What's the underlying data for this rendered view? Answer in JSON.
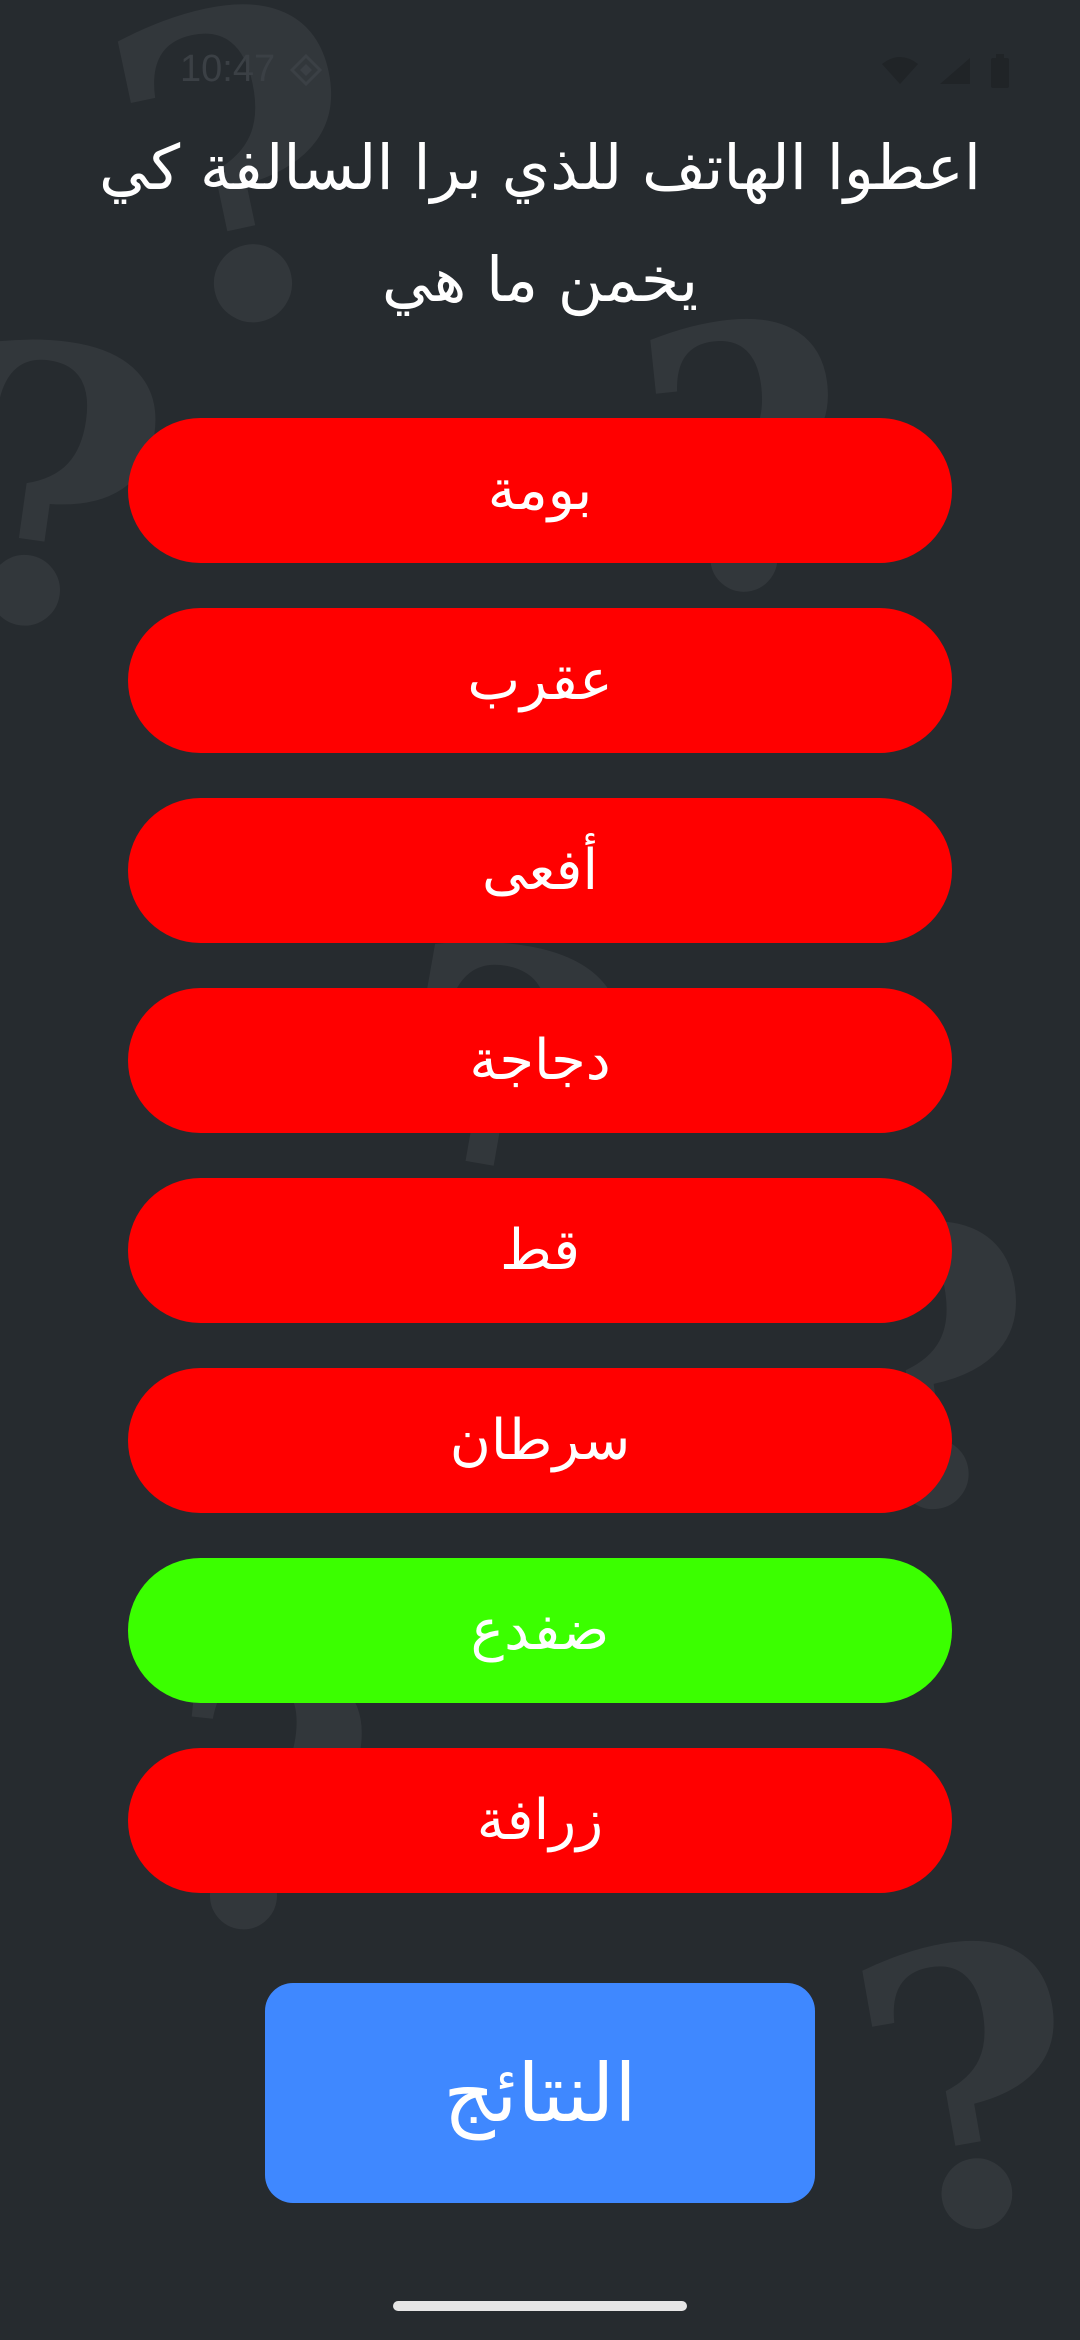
{
  "status_bar": {
    "time": "10:47",
    "icons": [
      "app-diamond-icon",
      "wifi-icon",
      "signal-icon",
      "battery-icon"
    ]
  },
  "prompt": {
    "line1": "اعطوا الهاتف للذي برا السالفة كي",
    "line2": "يخمن ما هي"
  },
  "options": [
    {
      "label": "بومة",
      "state": "wrong"
    },
    {
      "label": "عقرب",
      "state": "wrong"
    },
    {
      "label": "أفعى",
      "state": "wrong"
    },
    {
      "label": "دجاجة",
      "state": "wrong"
    },
    {
      "label": "قط",
      "state": "wrong"
    },
    {
      "label": "سرطان",
      "state": "wrong"
    },
    {
      "label": "ضفدع",
      "state": "correct"
    },
    {
      "label": "زرافة",
      "state": "wrong"
    }
  ],
  "results_button": {
    "label": "النتائج"
  },
  "colors": {
    "background": "#262b2f",
    "wrong": "#ff0000",
    "correct": "#3bff00",
    "results": "#3f88ff"
  }
}
